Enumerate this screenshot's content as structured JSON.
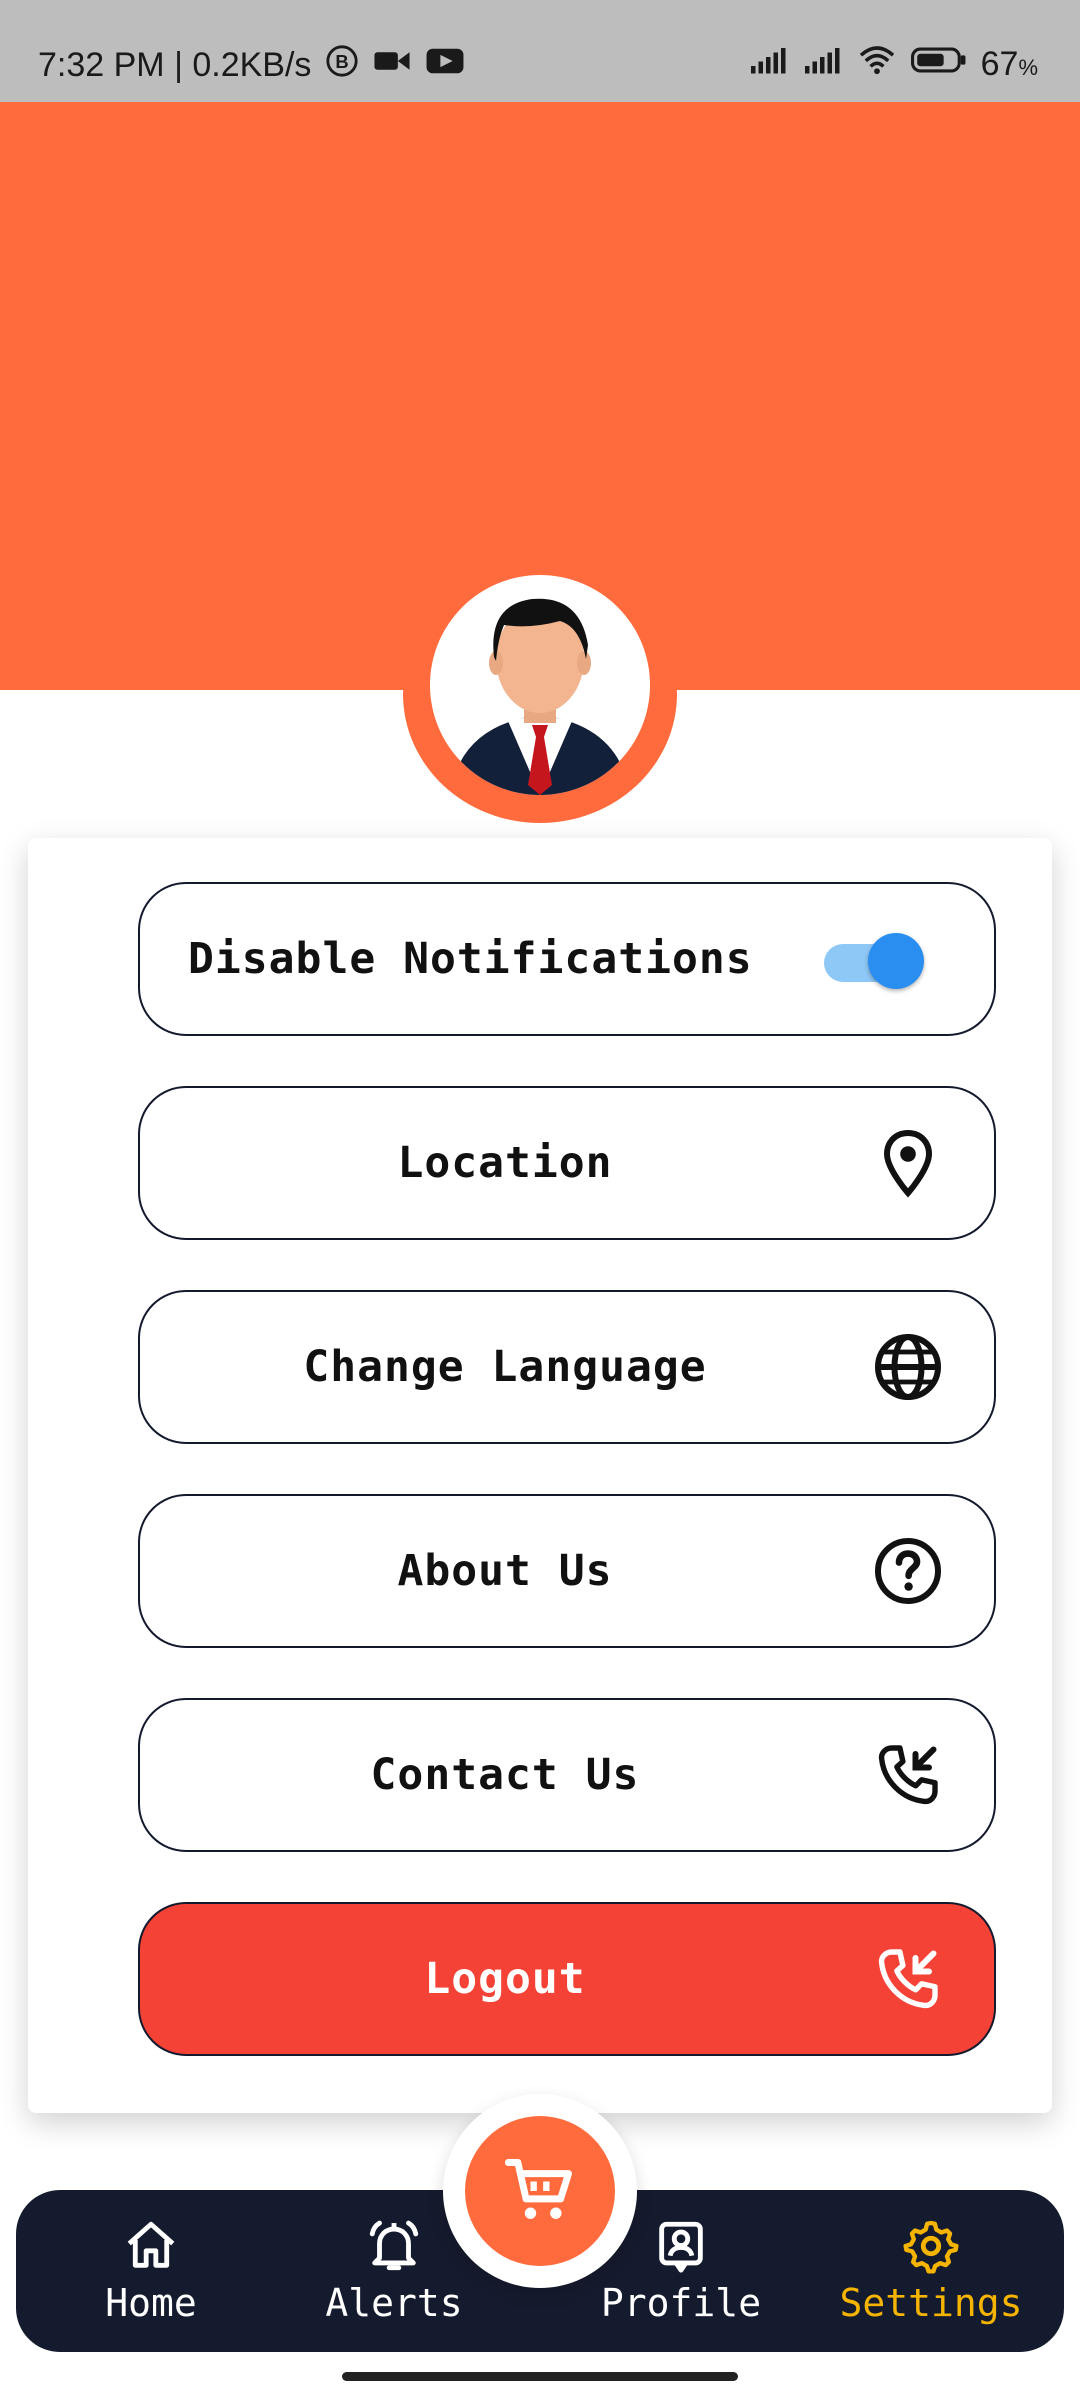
{
  "status_bar": {
    "time_speed": "7:32 PM | 0.2KB/s",
    "battery": "67",
    "battery_unit": "%",
    "icons": [
      "b-icon",
      "video-camera-icon",
      "youtube-icon",
      "signal-icon",
      "signal-icon",
      "wifi-icon",
      "battery-icon"
    ]
  },
  "header": {
    "color": "#ff6b3d",
    "avatar": "businessman-avatar"
  },
  "settings": {
    "notifications": {
      "label": "Disable Notifications",
      "toggle_on": true
    },
    "location": {
      "label": "Location",
      "icon": "location-pin-icon"
    },
    "language": {
      "label": "Change Language",
      "icon": "globe-icon"
    },
    "about": {
      "label": "About Us",
      "icon": "help-circle-icon"
    },
    "contact": {
      "label": "Contact Us",
      "icon": "phone-callback-icon"
    },
    "logout": {
      "label": "Logout",
      "icon": "phone-callback-icon",
      "color": "#f44336"
    }
  },
  "nav": {
    "items": [
      {
        "label": "Home",
        "icon": "home-icon"
      },
      {
        "label": "Alerts",
        "icon": "bell-icon"
      },
      {
        "label": "Profile",
        "icon": "profile-icon"
      },
      {
        "label": "Settings",
        "icon": "gear-icon",
        "active": true
      }
    ],
    "center_button_icon": "cart-icon",
    "active_color": "#f5b400"
  }
}
